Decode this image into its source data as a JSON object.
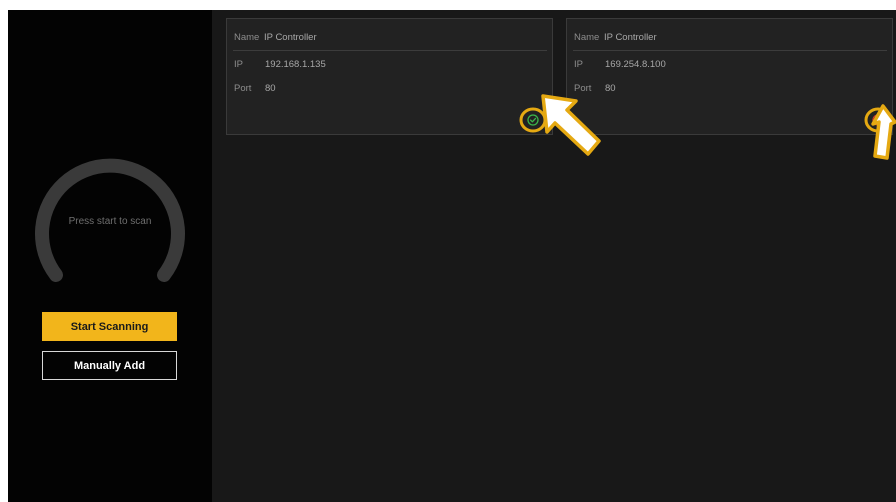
{
  "sidebar": {
    "scan_prompt": "Press start to scan",
    "start_button": "Start Scanning",
    "manual_button": "Manually Add"
  },
  "devices": [
    {
      "name_label": "Name",
      "name": "IP Controller",
      "ip_label": "IP",
      "ip": "192.168.1.135",
      "port_label": "Port",
      "port": "80",
      "status": "connected",
      "status_icon": "check-circle-icon",
      "status_color": "#3bb54a"
    },
    {
      "name_label": "Name",
      "name": "IP Controller",
      "ip_label": "IP",
      "ip": "169.254.8.100",
      "port_label": "Port",
      "port": "80",
      "status": "error",
      "status_icon": "alert-circle-icon",
      "status_color": "#d23a2a"
    }
  ],
  "colors": {
    "accent": "#f2b51b",
    "sidebar_bg": "#030303",
    "main_bg": "#181818",
    "card_bg": "#222222",
    "annotation": "#e5a912"
  }
}
